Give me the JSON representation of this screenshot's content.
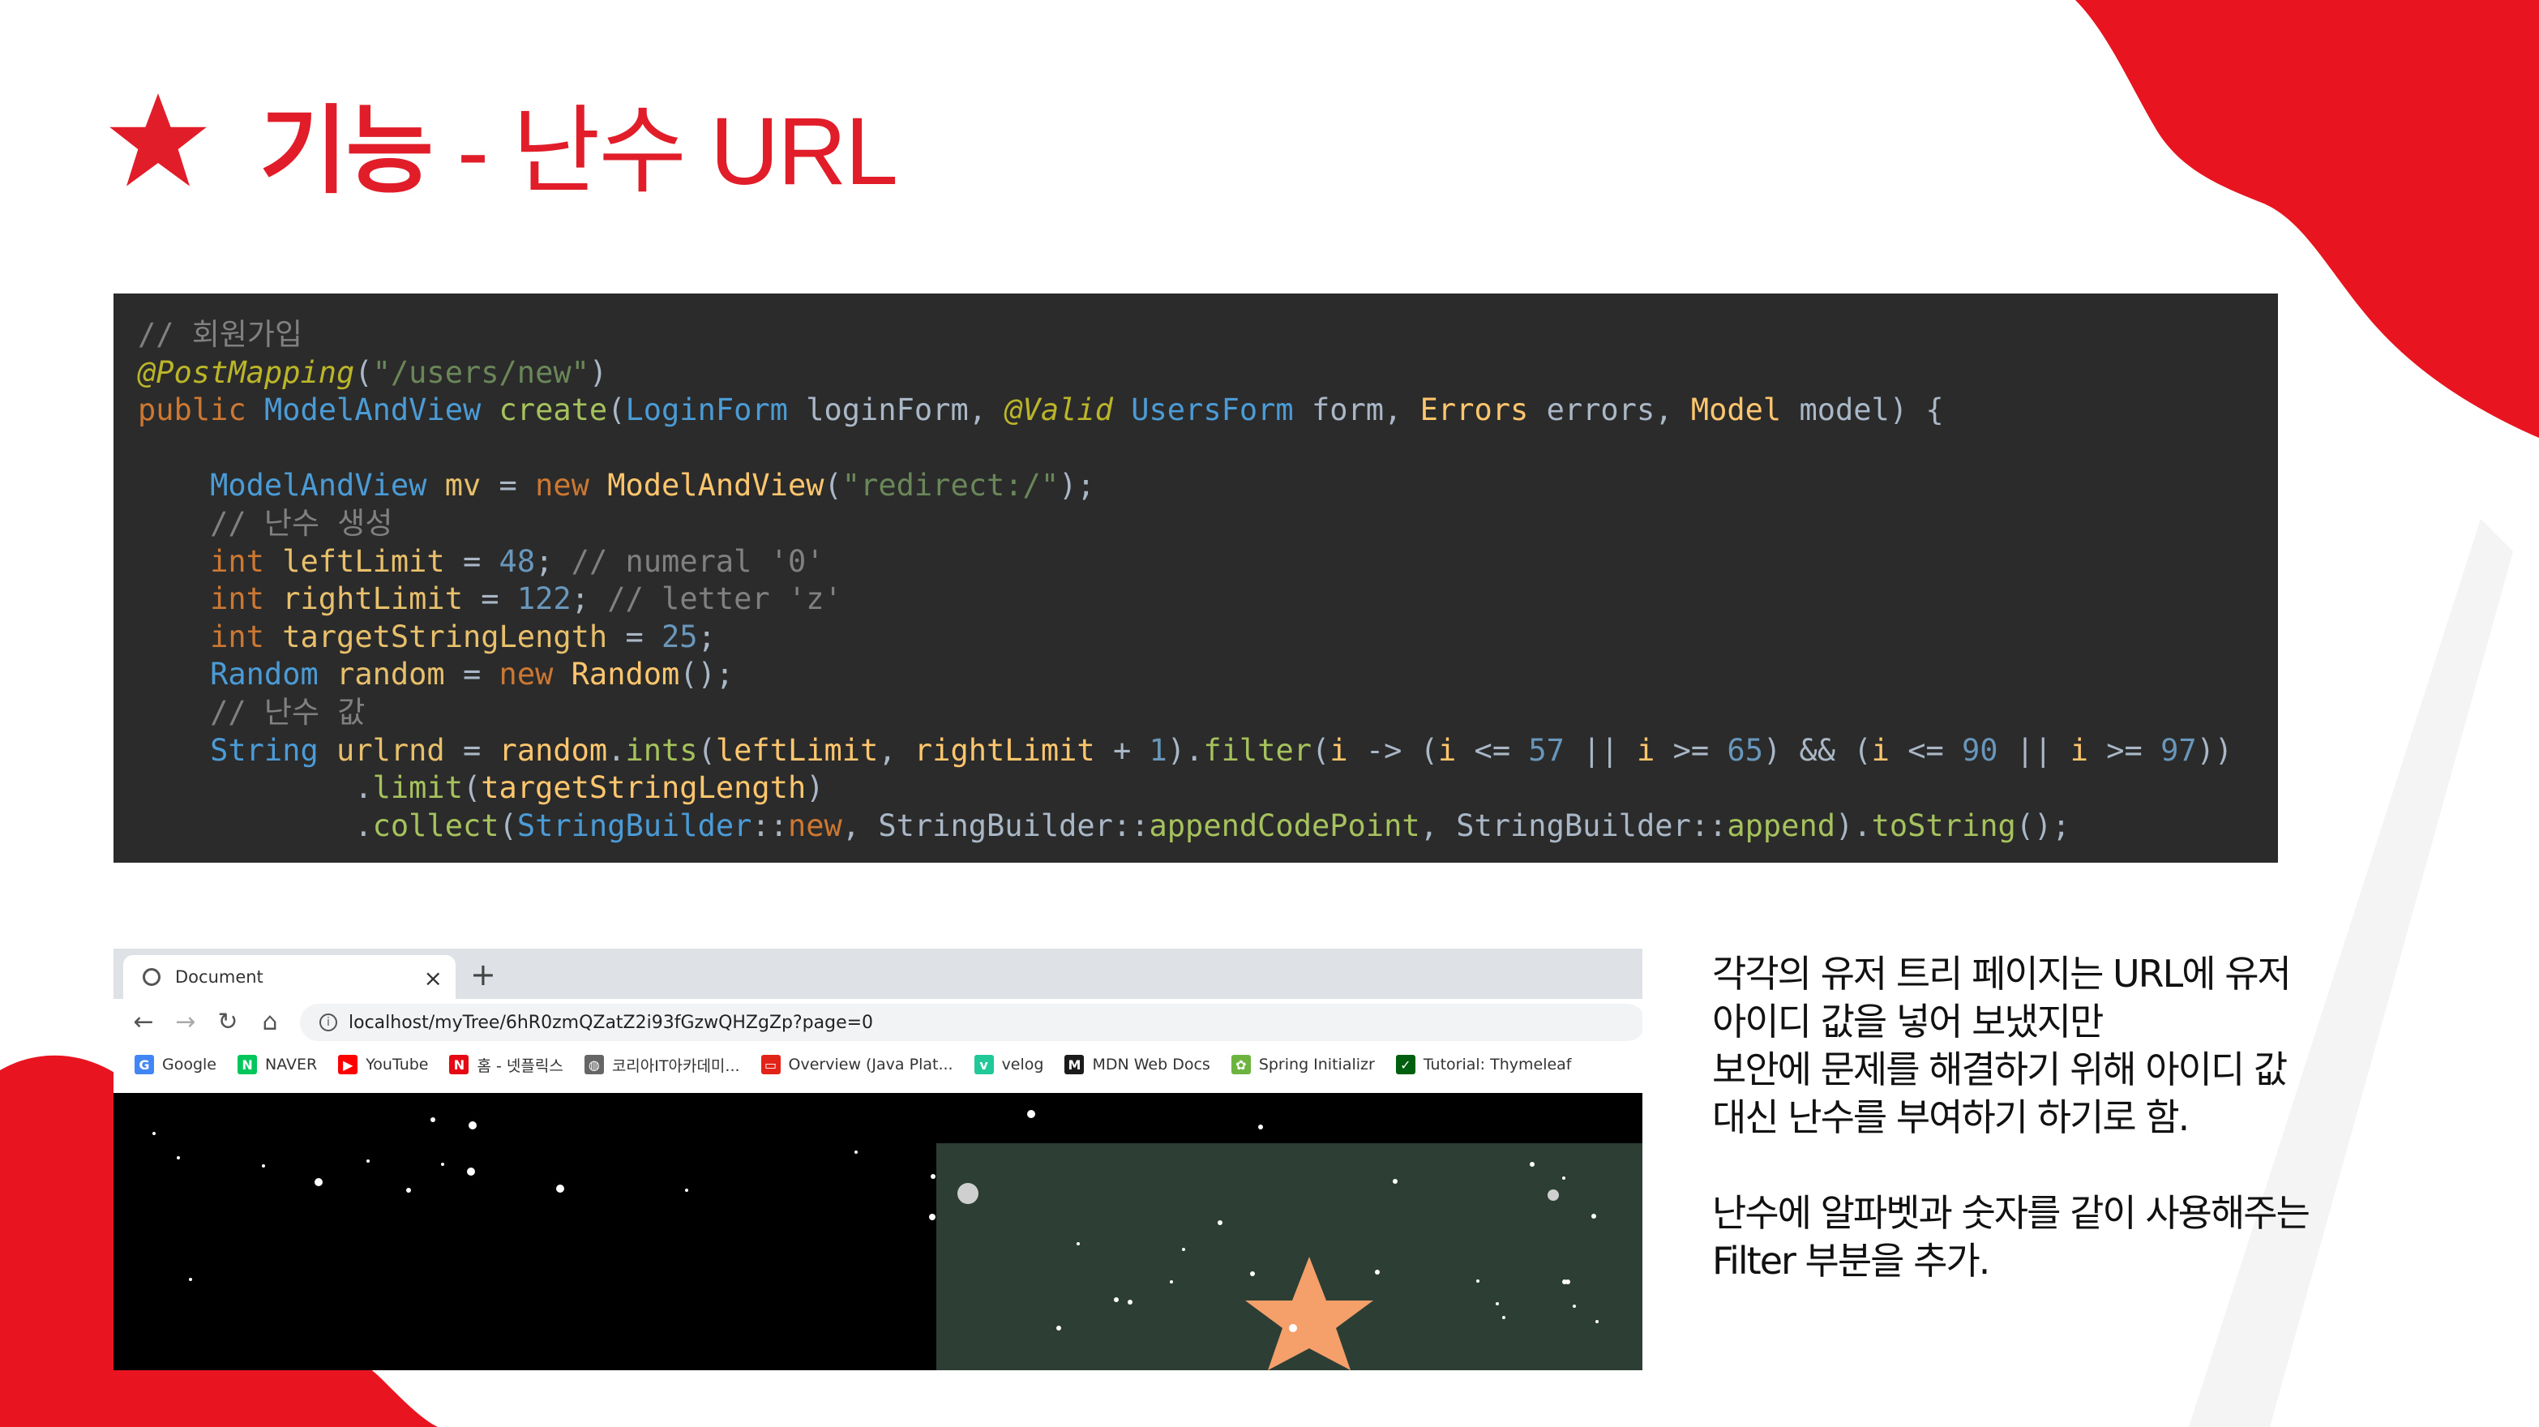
{
  "slide": {
    "title_bold": "기능",
    "title_rest": " - 난수 URL",
    "accent_color": "#e11d2a"
  },
  "code_lines": [
    [
      {
        "c": "cm",
        "t": "// 회원가입"
      }
    ],
    [
      {
        "c": "an",
        "t": "@PostMapping"
      },
      {
        "c": "",
        "t": "("
      },
      {
        "c": "st",
        "t": "\"/users/new\""
      },
      {
        "c": "",
        "t": ")"
      }
    ],
    [
      {
        "c": "kw",
        "t": "public "
      },
      {
        "c": "ty",
        "t": "ModelAndView "
      },
      {
        "c": "gr",
        "t": "create"
      },
      {
        "c": "",
        "t": "("
      },
      {
        "c": "ty",
        "t": "LoginForm "
      },
      {
        "c": "",
        "t": "loginForm, "
      },
      {
        "c": "an",
        "t": "@Valid "
      },
      {
        "c": "ty",
        "t": "UsersForm "
      },
      {
        "c": "",
        "t": "form, "
      },
      {
        "c": "fn",
        "t": "Errors "
      },
      {
        "c": "",
        "t": "errors, "
      },
      {
        "c": "fn",
        "t": "Model "
      },
      {
        "c": "",
        "t": "model) {"
      }
    ],
    [],
    [
      {
        "c": "",
        "t": "    "
      },
      {
        "c": "ty",
        "t": "ModelAndView "
      },
      {
        "c": "va",
        "t": "mv "
      },
      {
        "c": "",
        "t": "= "
      },
      {
        "c": "kw",
        "t": "new "
      },
      {
        "c": "fn",
        "t": "ModelAndView"
      },
      {
        "c": "",
        "t": "("
      },
      {
        "c": "st",
        "t": "\"redirect:/\""
      },
      {
        "c": "",
        "t": ");"
      }
    ],
    [
      {
        "c": "",
        "t": "    "
      },
      {
        "c": "cm",
        "t": "// 난수 생성"
      }
    ],
    [
      {
        "c": "",
        "t": "    "
      },
      {
        "c": "kw",
        "t": "int "
      },
      {
        "c": "va",
        "t": "leftLimit "
      },
      {
        "c": "",
        "t": "= "
      },
      {
        "c": "nu",
        "t": "48"
      },
      {
        "c": "",
        "t": "; "
      },
      {
        "c": "cm",
        "t": "// numeral '0'"
      }
    ],
    [
      {
        "c": "",
        "t": "    "
      },
      {
        "c": "kw",
        "t": "int "
      },
      {
        "c": "va",
        "t": "rightLimit "
      },
      {
        "c": "",
        "t": "= "
      },
      {
        "c": "nu",
        "t": "122"
      },
      {
        "c": "",
        "t": "; "
      },
      {
        "c": "cm",
        "t": "// letter 'z'"
      }
    ],
    [
      {
        "c": "",
        "t": "    "
      },
      {
        "c": "kw",
        "t": "int "
      },
      {
        "c": "va",
        "t": "targetStringLength "
      },
      {
        "c": "",
        "t": "= "
      },
      {
        "c": "nu",
        "t": "25"
      },
      {
        "c": "",
        "t": ";"
      }
    ],
    [
      {
        "c": "",
        "t": "    "
      },
      {
        "c": "ty",
        "t": "Random "
      },
      {
        "c": "va",
        "t": "random "
      },
      {
        "c": "",
        "t": "= "
      },
      {
        "c": "kw",
        "t": "new "
      },
      {
        "c": "fn",
        "t": "Random"
      },
      {
        "c": "",
        "t": "();"
      }
    ],
    [
      {
        "c": "",
        "t": "    "
      },
      {
        "c": "cm",
        "t": "// 난수 값"
      }
    ],
    [
      {
        "c": "",
        "t": "    "
      },
      {
        "c": "ty",
        "t": "String "
      },
      {
        "c": "va",
        "t": "urlrnd "
      },
      {
        "c": "",
        "t": "= "
      },
      {
        "c": "fn",
        "t": "random"
      },
      {
        "c": "",
        "t": "."
      },
      {
        "c": "gr",
        "t": "ints"
      },
      {
        "c": "",
        "t": "("
      },
      {
        "c": "fn",
        "t": "leftLimit"
      },
      {
        "c": "",
        "t": ", "
      },
      {
        "c": "fn",
        "t": "rightLimit "
      },
      {
        "c": "",
        "t": "+ "
      },
      {
        "c": "nu",
        "t": "1"
      },
      {
        "c": "",
        "t": ")."
      },
      {
        "c": "gr",
        "t": "filter"
      },
      {
        "c": "",
        "t": "("
      },
      {
        "c": "fn",
        "t": "i "
      },
      {
        "c": "",
        "t": "-> ("
      },
      {
        "c": "fn",
        "t": "i "
      },
      {
        "c": "",
        "t": "<= "
      },
      {
        "c": "nu",
        "t": "57 "
      },
      {
        "c": "",
        "t": "|| "
      },
      {
        "c": "fn",
        "t": "i "
      },
      {
        "c": "",
        "t": ">= "
      },
      {
        "c": "nu",
        "t": "65"
      },
      {
        "c": "",
        "t": ") && ("
      },
      {
        "c": "fn",
        "t": "i "
      },
      {
        "c": "",
        "t": "<= "
      },
      {
        "c": "nu",
        "t": "90 "
      },
      {
        "c": "",
        "t": "|| "
      },
      {
        "c": "fn",
        "t": "i "
      },
      {
        "c": "",
        "t": ">= "
      },
      {
        "c": "nu",
        "t": "97"
      },
      {
        "c": "",
        "t": "))"
      }
    ],
    [
      {
        "c": "",
        "t": "            ."
      },
      {
        "c": "gr",
        "t": "limit"
      },
      {
        "c": "",
        "t": "("
      },
      {
        "c": "fn",
        "t": "targetStringLength"
      },
      {
        "c": "",
        "t": ")"
      }
    ],
    [
      {
        "c": "",
        "t": "            ."
      },
      {
        "c": "gr",
        "t": "collect"
      },
      {
        "c": "",
        "t": "("
      },
      {
        "c": "ty",
        "t": "StringBuilder"
      },
      {
        "c": "",
        "t": "::"
      },
      {
        "c": "kw",
        "t": "new"
      },
      {
        "c": "",
        "t": ", StringBuilder::"
      },
      {
        "c": "gr",
        "t": "appendCodePoint"
      },
      {
        "c": "",
        "t": ", StringBuilder::"
      },
      {
        "c": "gr",
        "t": "append"
      },
      {
        "c": "",
        "t": ")."
      },
      {
        "c": "gr",
        "t": "toString"
      },
      {
        "c": "",
        "t": "();"
      }
    ]
  ],
  "browser": {
    "tab_title": "Document",
    "tab_close": "×",
    "new_tab": "+",
    "url": "localhost/myTree/6hR0zmQZatZ2i93fGzwQHZgZp?page=0",
    "bookmarks": [
      {
        "label": "Google",
        "icon": "google-icon",
        "color": "#4285f4",
        "glyph": "G"
      },
      {
        "label": "NAVER",
        "icon": "naver-icon",
        "color": "#03c75a",
        "glyph": "N"
      },
      {
        "label": "YouTube",
        "icon": "youtube-icon",
        "color": "#ff0000",
        "glyph": "▶"
      },
      {
        "label": "홈 - 넷플릭스",
        "icon": "netflix-icon",
        "color": "#e50914",
        "glyph": "N"
      },
      {
        "label": "코리아IT아카데미...",
        "icon": "globe-icon",
        "color": "#666666",
        "glyph": "◍"
      },
      {
        "label": "Overview (Java Plat...",
        "icon": "oracle-icon",
        "color": "#e2231a",
        "glyph": "▭"
      },
      {
        "label": "velog",
        "icon": "velog-icon",
        "color": "#20c997",
        "glyph": "v"
      },
      {
        "label": "MDN Web Docs",
        "icon": "mdn-icon",
        "color": "#1b1b1b",
        "glyph": "M"
      },
      {
        "label": "Spring Initializr",
        "icon": "spring-icon",
        "color": "#6db33f",
        "glyph": "✿"
      },
      {
        "label": "Tutorial: Thymeleaf",
        "icon": "thymeleaf-icon",
        "color": "#005f0f",
        "glyph": "✓"
      }
    ]
  },
  "description": {
    "lines": [
      "각각의 유저 트리 페이지는 URL에 유저",
      "아이디  값을 넣어 보냈지만",
      "보안에 문제를 해결하기 위해 아이디 값",
      "대신 난수를 부여하기 하기로 함.",
      "",
      "난수에 알파벳과 숫자를 같이 사용해주는",
      "Filter 부분을 추가."
    ]
  }
}
